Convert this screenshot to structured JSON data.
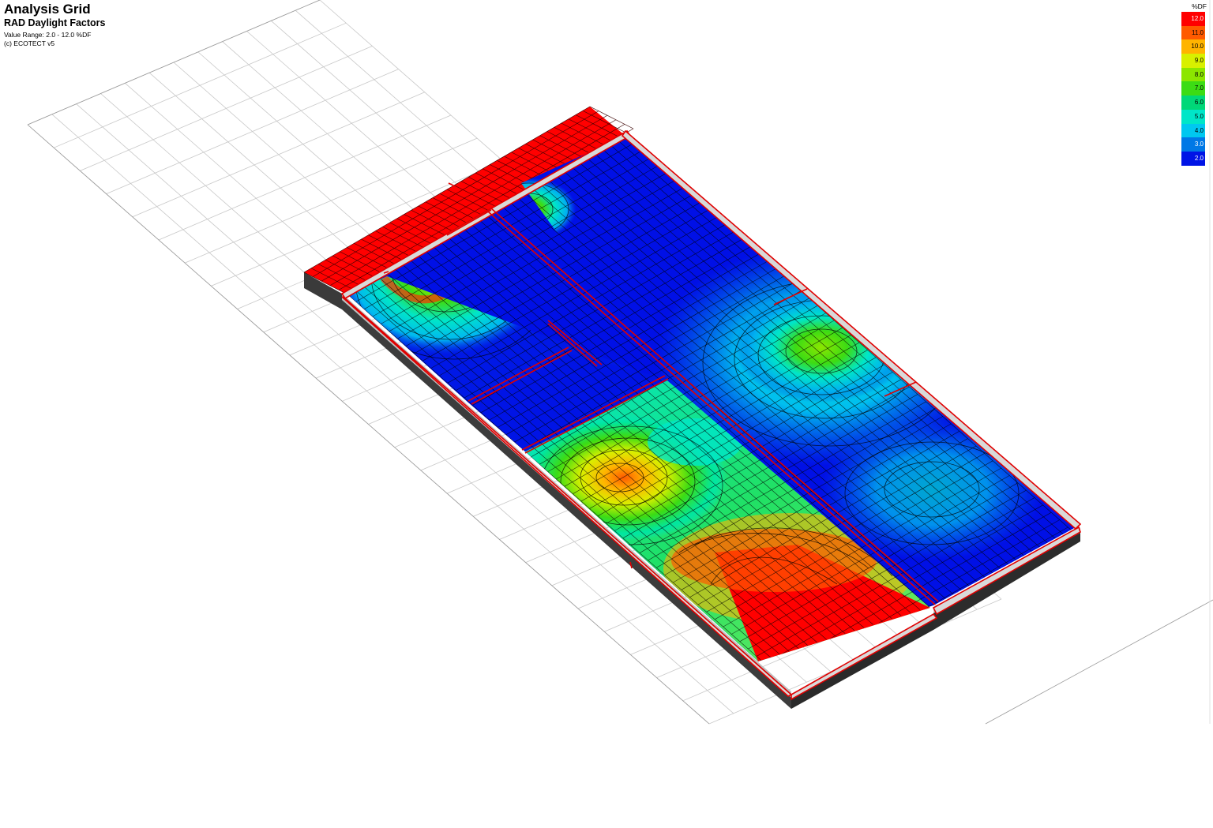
{
  "header": {
    "title": "Analysis Grid",
    "subtitle": "RAD Daylight Factors",
    "value_range": "Value Range: 2.0 - 12.0 %DF",
    "copyright": "(c) ECOTECT v5"
  },
  "legend": {
    "unit": "%DF",
    "items": [
      {
        "value": "12.0",
        "color": "#ff0000"
      },
      {
        "value": "11.0",
        "color": "#ff5a00"
      },
      {
        "value": "10.0",
        "color": "#ffb400"
      },
      {
        "value": "9.0",
        "color": "#d8f000"
      },
      {
        "value": "8.0",
        "color": "#8ce600"
      },
      {
        "value": "7.0",
        "color": "#3cdc14"
      },
      {
        "value": "6.0",
        "color": "#00d878"
      },
      {
        "value": "5.0",
        "color": "#00e6c8"
      },
      {
        "value": "4.0",
        "color": "#00c8f0"
      },
      {
        "value": "3.0",
        "color": "#0078e6"
      },
      {
        "value": "2.0",
        "color": "#0014e6"
      }
    ]
  }
}
